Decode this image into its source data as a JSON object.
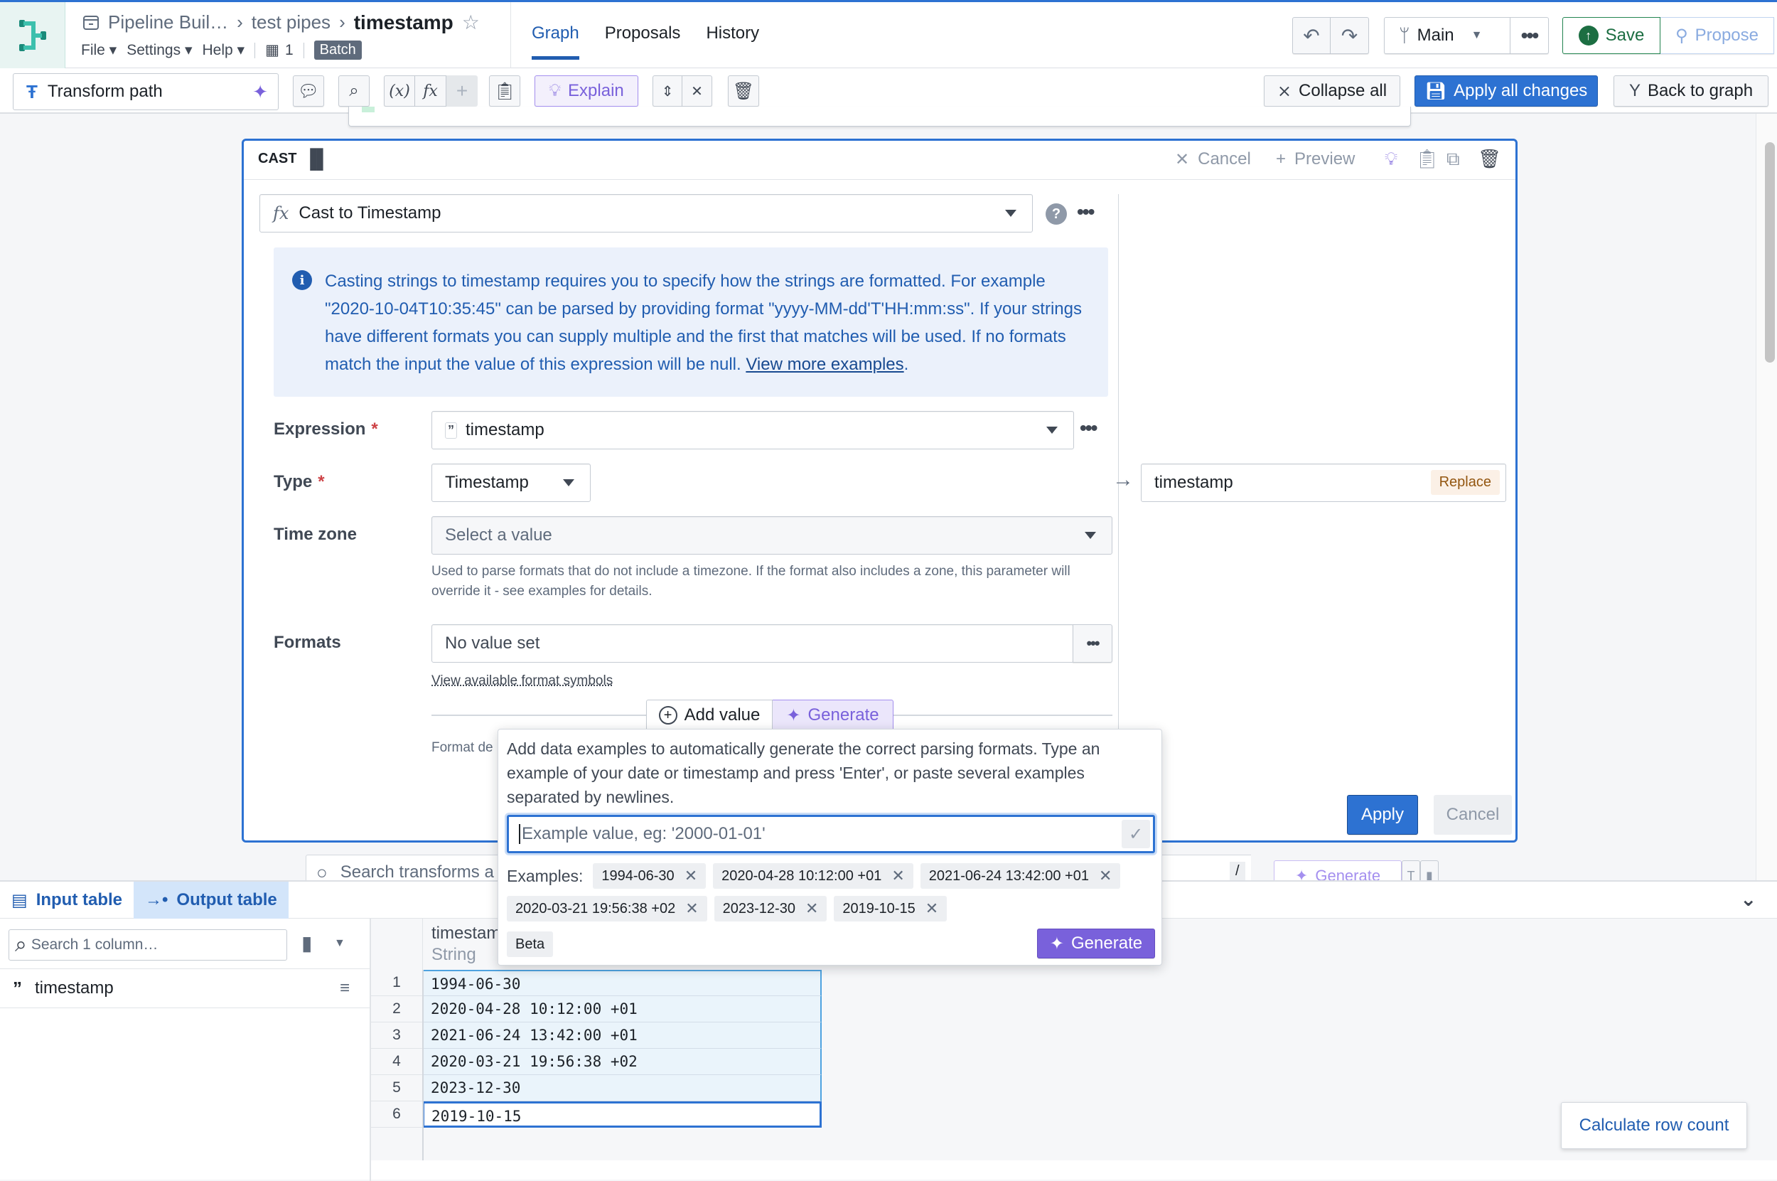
{
  "header": {
    "breadcrumb": [
      "Pipeline Buil…",
      "test pipes"
    ],
    "title": "timestamp",
    "menus": [
      "File",
      "Settings",
      "Help"
    ],
    "build_count": "1",
    "mode_badge": "Batch",
    "tabs": [
      {
        "label": "Graph",
        "active": true
      },
      {
        "label": "Proposals",
        "active": false
      },
      {
        "label": "History",
        "active": false
      }
    ],
    "branch": "Main",
    "save_label": "Save",
    "propose_label": "Propose"
  },
  "toolbar": {
    "transform_path_label": "Transform path",
    "explain_label": "Explain",
    "collapse_all_label": "Collapse all",
    "apply_all_label": "Apply all changes",
    "back_to_graph_label": "Back to graph"
  },
  "cast_card": {
    "header_label": "CAST",
    "cancel_label": "Cancel",
    "preview_label": "Preview",
    "function_name": "Cast to Timestamp",
    "callout": {
      "text": "Casting strings to timestamp requires you to specify how the strings are formatted. For example \"2020-10-04T10:35:45\" can be parsed by providing format \"yyyy-MM-dd'T'HH:mm:ss\". If your strings have different formats you can supply multiple and the first that matches will be used. If no formats match the input the value of this expression will be null.",
      "link": "View more examples"
    },
    "fields": {
      "expression_label": "Expression",
      "expression_value": "timestamp",
      "type_label": "Type",
      "type_value": "Timestamp",
      "timezone_label": "Time zone",
      "timezone_placeholder": "Select a value",
      "timezone_help": "Used to parse formats that do not include a timezone. If the format also includes a zone, this parameter will override it - see examples for details.",
      "formats_label": "Formats",
      "formats_value": "No value set",
      "formats_link": "View available format symbols",
      "add_value_label": "Add value",
      "generate_label": "Generate",
      "format_desc_partial": "Format de"
    },
    "output_column": "timestamp",
    "output_action": "Replace",
    "apply_label": "Apply",
    "cancel_button_label": "Cancel"
  },
  "popover": {
    "description": "Add data examples to automatically generate the correct parsing formats. Type an example of your date or timestamp and press 'Enter', or paste several examples separated by newlines.",
    "input_placeholder": "Example value, eg: '2000-01-01'",
    "examples_label": "Examples:",
    "examples": [
      "1994-06-30",
      "2020-04-28 10:12:00 +01",
      "2021-06-24 13:42:00 +01",
      "2020-03-21 19:56:38 +02",
      "2023-12-30",
      "2019-10-15"
    ],
    "beta_label": "Beta",
    "generate_label": "Generate"
  },
  "behind_search": {
    "placeholder": "Search transforms a",
    "shortcut": "/",
    "generate_label": "Generate"
  },
  "bottom_panel": {
    "tabs": [
      {
        "label": "Input table",
        "active": false
      },
      {
        "label": "Output table",
        "active": true
      }
    ],
    "column_search_placeholder": "Search 1 column…",
    "columns": [
      {
        "name": "timestamp",
        "type_icon": "string-quote-icon"
      }
    ],
    "table": {
      "header": {
        "name": "timestam",
        "type": "String"
      },
      "row_numbers": [
        "1",
        "2",
        "3",
        "4",
        "5",
        "6"
      ],
      "rows": [
        "1994-06-30",
        "2020-04-28 10:12:00 +01",
        "2021-06-24 13:42:00 +01",
        "2020-03-21 19:56:38 +02",
        "2023-12-30",
        "2019-10-15"
      ]
    },
    "row_count_label": "Calculate row count"
  },
  "colors": {
    "primary": "#2d72d2",
    "accent_purple": "#7961db",
    "save_green": "#1c6e42",
    "callout_bg": "#ebf1fb",
    "replace_bg": "#fbf0e6",
    "replace_text": "#935610"
  }
}
